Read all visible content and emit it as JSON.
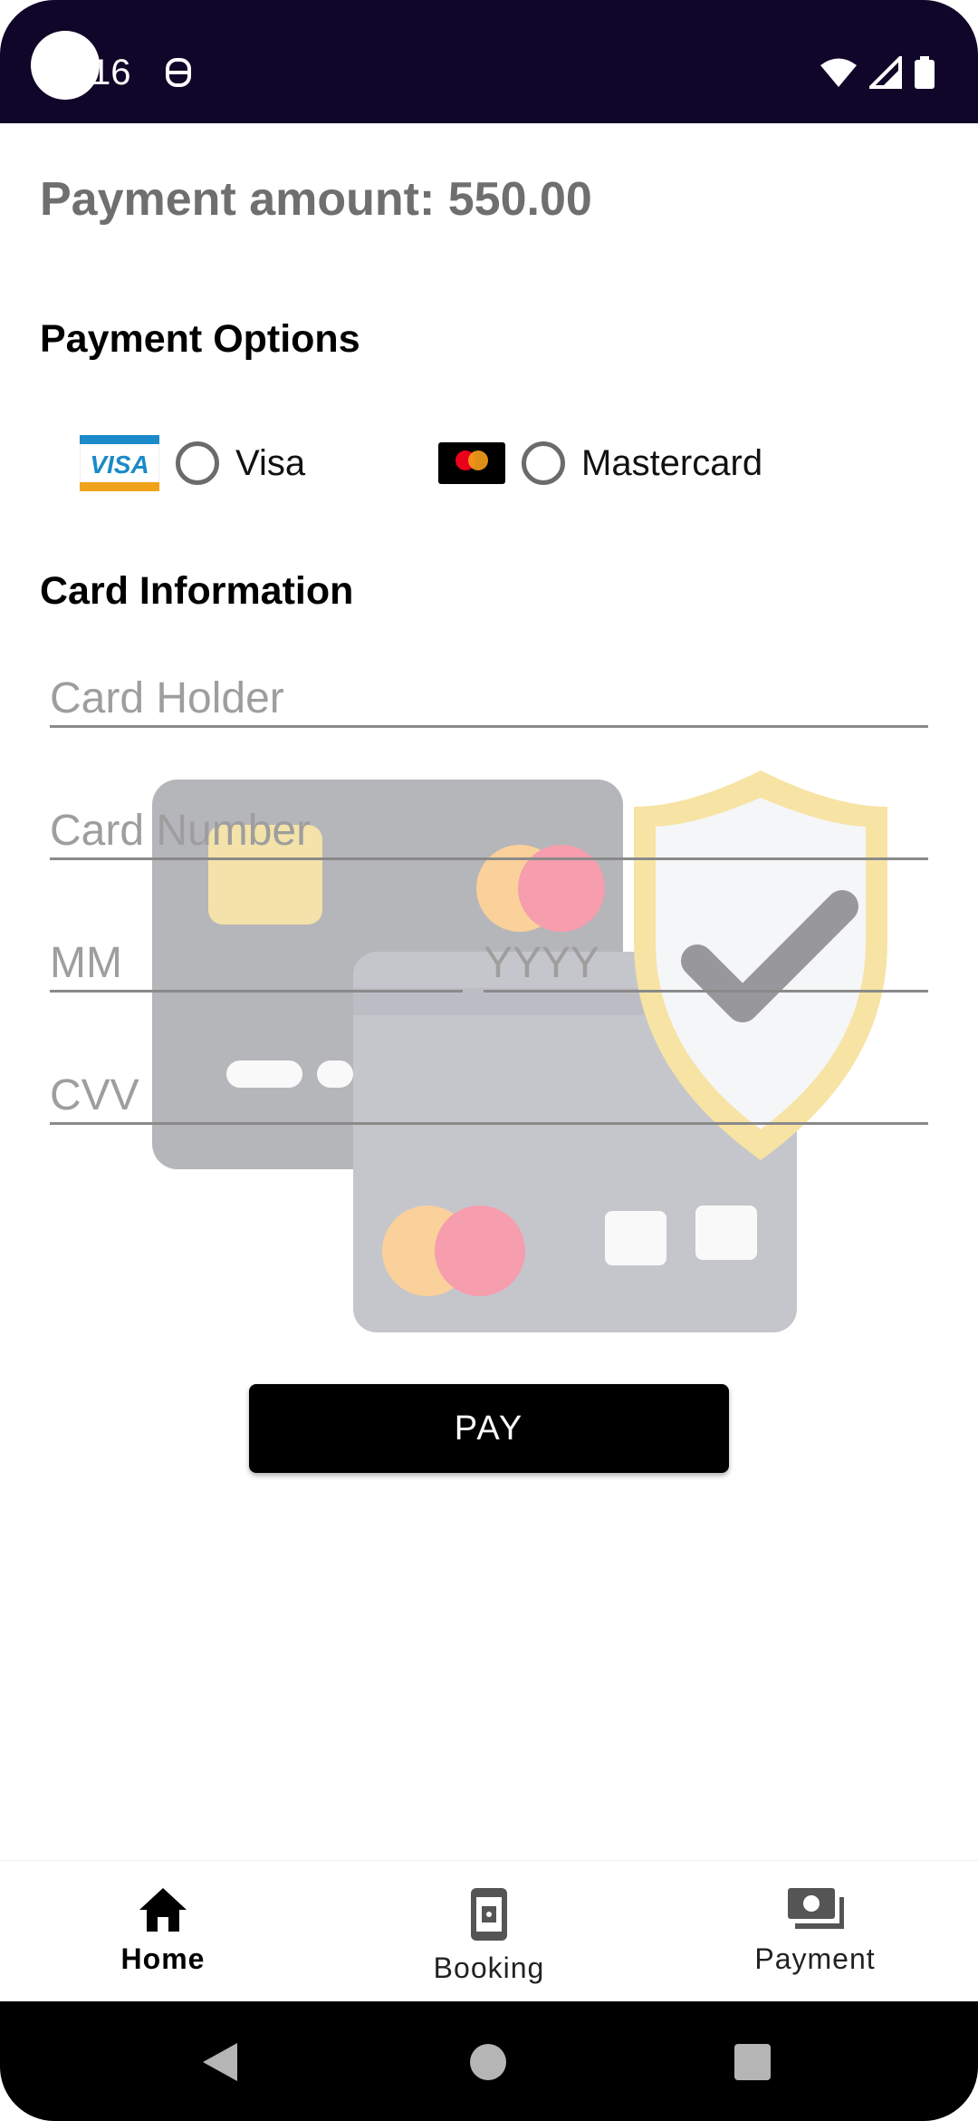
{
  "status_bar": {
    "time": "16"
  },
  "payment": {
    "amount_label": "Payment amount: 550.00"
  },
  "payment_options": {
    "title": "Payment Options",
    "options": [
      {
        "label": "Visa",
        "logo_text": "VISA",
        "selected": false
      },
      {
        "label": "Mastercard",
        "selected": false
      }
    ]
  },
  "card_info": {
    "title": "Card Information",
    "holder_placeholder": "Card Holder",
    "number_placeholder": "Card Number",
    "month_placeholder": "MM",
    "year_placeholder": "YYYY",
    "cvv_placeholder": "CVV"
  },
  "pay_button": {
    "label": "PAY"
  },
  "bottom_nav": {
    "items": [
      {
        "label": "Home",
        "icon": "home-icon",
        "active": true
      },
      {
        "label": "Booking",
        "icon": "booking-icon",
        "active": false
      },
      {
        "label": "Payment",
        "icon": "payment-icon",
        "active": false
      }
    ]
  },
  "colors": {
    "status_bar": "#10062a",
    "accent": "#000000",
    "amount_text": "#6f6f6f"
  }
}
